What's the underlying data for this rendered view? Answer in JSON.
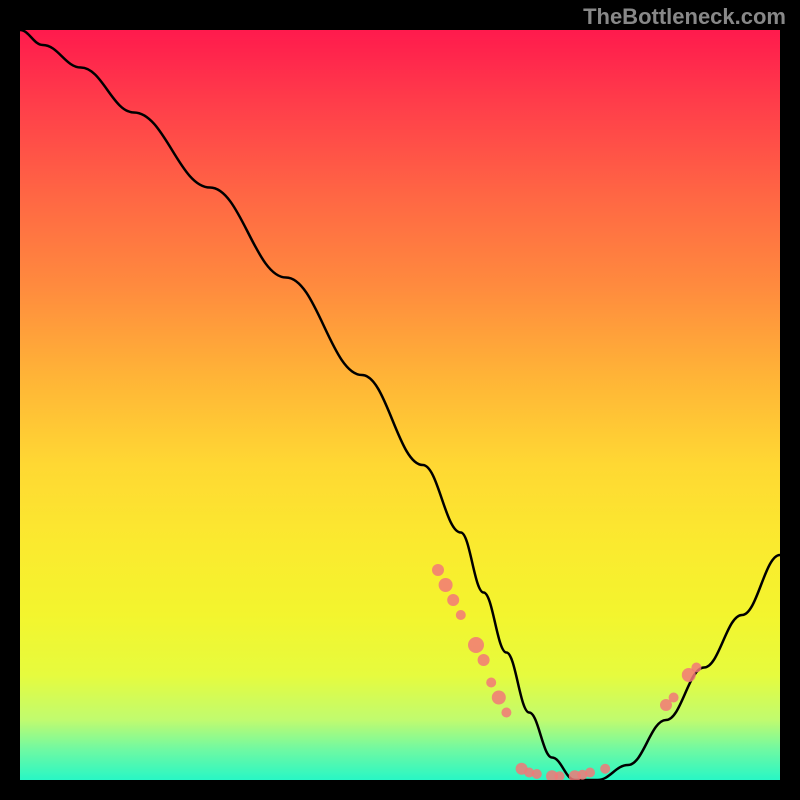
{
  "watermark": "TheBottleneck.com",
  "chart_data": {
    "type": "line",
    "title": "",
    "xlabel": "",
    "ylabel": "",
    "xlim": [
      0,
      100
    ],
    "ylim": [
      0,
      100
    ],
    "series": [
      {
        "name": "curve",
        "x": [
          0,
          3,
          8,
          15,
          25,
          35,
          45,
          53,
          58,
          61,
          64,
          67,
          70,
          73,
          76,
          80,
          85,
          90,
          95,
          100
        ],
        "y": [
          100,
          98,
          95,
          89,
          79,
          67,
          54,
          42,
          33,
          25,
          17,
          9,
          3,
          0,
          0,
          2,
          8,
          15,
          22,
          30
        ]
      }
    ],
    "markers": [
      {
        "x": 55,
        "y": 28,
        "r": 6
      },
      {
        "x": 56,
        "y": 26,
        "r": 7
      },
      {
        "x": 57,
        "y": 24,
        "r": 6
      },
      {
        "x": 58,
        "y": 22,
        "r": 5
      },
      {
        "x": 60,
        "y": 18,
        "r": 8
      },
      {
        "x": 61,
        "y": 16,
        "r": 6
      },
      {
        "x": 62,
        "y": 13,
        "r": 5
      },
      {
        "x": 63,
        "y": 11,
        "r": 7
      },
      {
        "x": 64,
        "y": 9,
        "r": 5
      },
      {
        "x": 66,
        "y": 1.5,
        "r": 6
      },
      {
        "x": 67,
        "y": 1,
        "r": 5
      },
      {
        "x": 68,
        "y": 0.8,
        "r": 5
      },
      {
        "x": 70,
        "y": 0.5,
        "r": 6
      },
      {
        "x": 71,
        "y": 0.5,
        "r": 5
      },
      {
        "x": 73,
        "y": 0.5,
        "r": 6
      },
      {
        "x": 74,
        "y": 0.7,
        "r": 5
      },
      {
        "x": 75,
        "y": 1,
        "r": 5
      },
      {
        "x": 77,
        "y": 1.5,
        "r": 5
      },
      {
        "x": 85,
        "y": 10,
        "r": 6
      },
      {
        "x": 86,
        "y": 11,
        "r": 5
      },
      {
        "x": 88,
        "y": 14,
        "r": 7
      },
      {
        "x": 89,
        "y": 15,
        "r": 5
      }
    ],
    "gradient_stops": [
      {
        "pos": 0,
        "color": "#ff1a4d"
      },
      {
        "pos": 50,
        "color": "#ffd833"
      },
      {
        "pos": 100,
        "color": "#28f7c5"
      }
    ]
  }
}
